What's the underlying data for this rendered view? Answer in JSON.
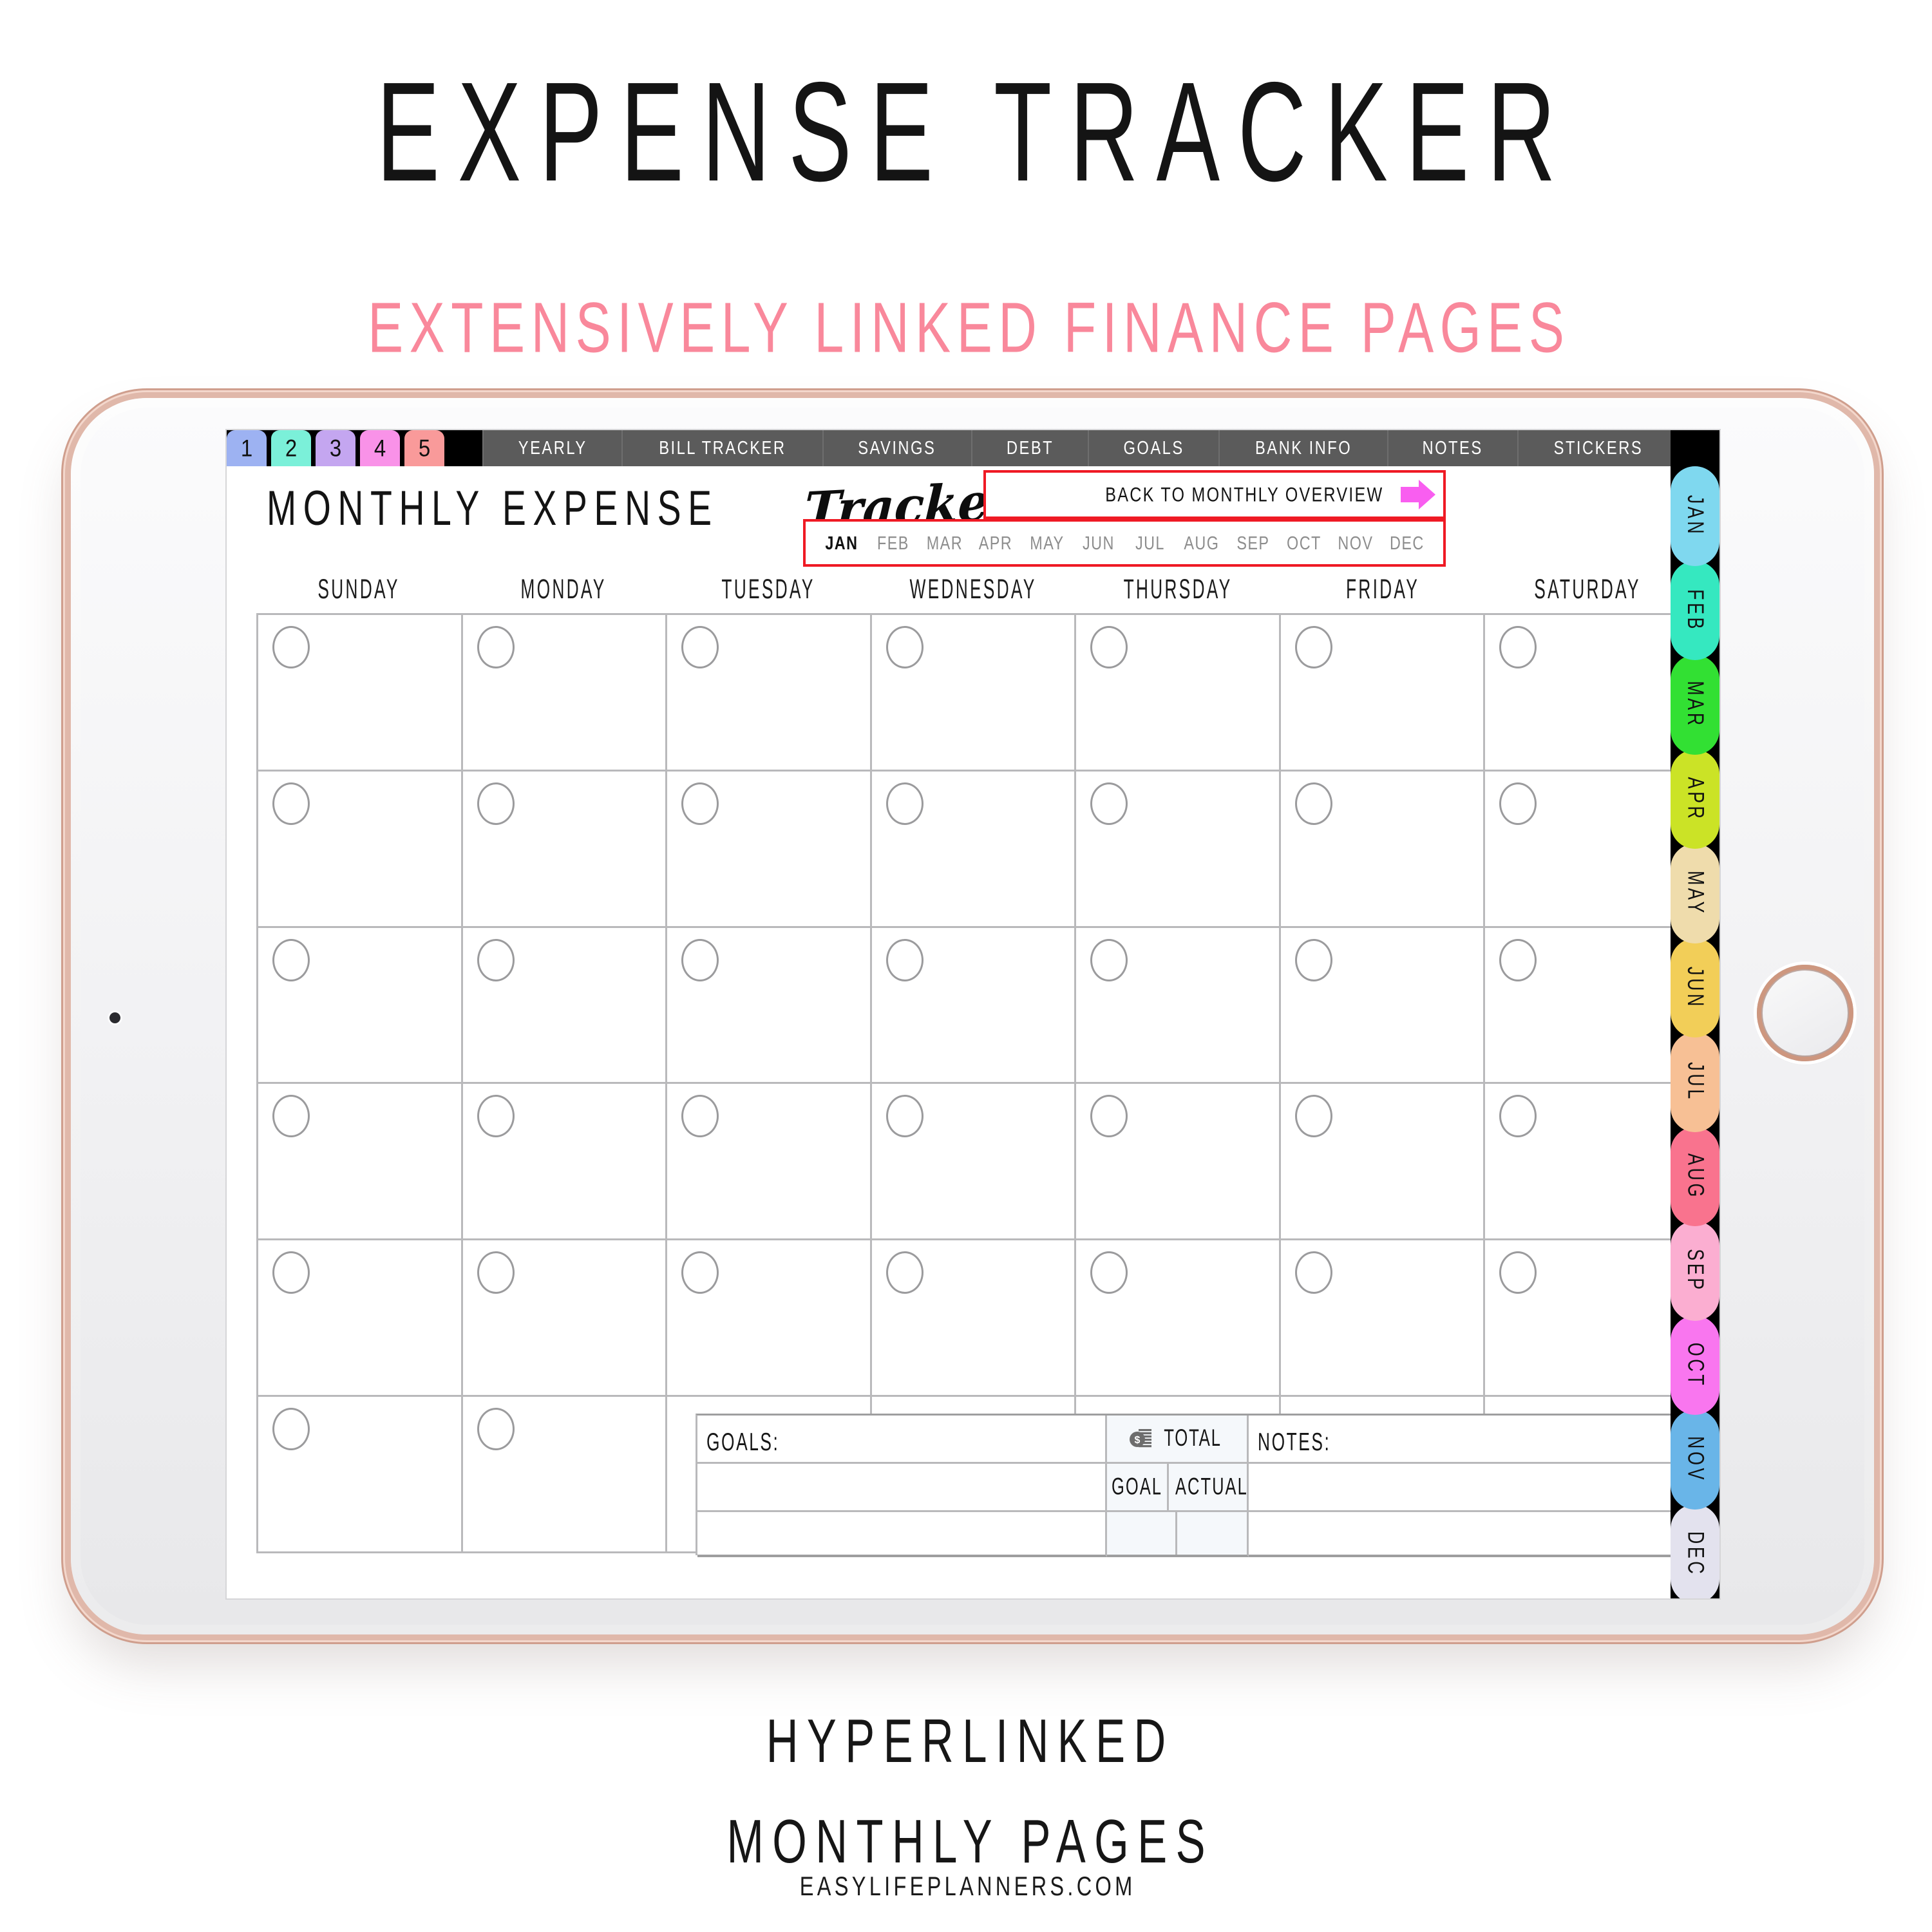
{
  "marketing": {
    "hero_title": "EXPENSE TRACKER",
    "hero_subtitle": "EXTENSIVELY LINKED FINANCE PAGES",
    "footer_line1": "HYPERLINKED",
    "footer_line2": "MONTHLY PAGES",
    "footer_url": "EASYLIFEPLANNERS.COM"
  },
  "colors": {
    "accent_pink": "#f9889b",
    "link_box_red": "#ef1a24",
    "arrow_magenta": "#f95ef0",
    "navbar_gray": "#5b5b5b",
    "device_rose_gold": "#cf9e8d",
    "grid_line": "#b9b9bb"
  },
  "device": {
    "home_button": "home-button",
    "camera": "front-camera"
  },
  "topnav": {
    "number_tabs": [
      {
        "label": "1",
        "color": "#9db2f2"
      },
      {
        "label": "2",
        "color": "#7bf0d9"
      },
      {
        "label": "3",
        "color": "#c4a6f0"
      },
      {
        "label": "4",
        "color": "#f992e8"
      },
      {
        "label": "5",
        "color": "#f99a9a"
      }
    ],
    "links": [
      "YEARLY",
      "BILL TRACKER",
      "SAVINGS",
      "DEBT",
      "GOALS",
      "BANK INFO",
      "NOTES",
      "STICKERS"
    ],
    "home_icon": "home-icon"
  },
  "page": {
    "title_thin": "MONTHLY EXPENSE",
    "title_script": "Tracker",
    "back_link": {
      "label": "BACK TO MONTHLY OVERVIEW",
      "arrow_icon": "arrow-right-icon"
    },
    "month_selector": {
      "active": "JAN",
      "months": [
        "JAN",
        "FEB",
        "MAR",
        "APR",
        "MAY",
        "JUN",
        "JUL",
        "AUG",
        "SEP",
        "OCT",
        "NOV",
        "DEC"
      ]
    },
    "day_headers": [
      "SUNDAY",
      "MONDAY",
      "TUESDAY",
      "WEDNESDAY",
      "THURSDAY",
      "FRIDAY",
      "SATURDAY"
    ],
    "calendar": {
      "rows": 6,
      "columns": 7,
      "date_circles_per_cell": 1
    },
    "bottom_section": {
      "goals_label": "GOALS:",
      "total_label": "TOTAL",
      "total_icon": "money-icon",
      "goal_label": "GOAL",
      "actual_label": "ACTUAL",
      "notes_label": "NOTES:"
    }
  },
  "month_tabs": [
    {
      "label": "JAN",
      "color": "#7fd8ef"
    },
    {
      "label": "FEB",
      "color": "#35e8c0"
    },
    {
      "label": "MAR",
      "color": "#32e033"
    },
    {
      "label": "APR",
      "color": "#cbe326"
    },
    {
      "label": "MAY",
      "color": "#efdcac"
    },
    {
      "label": "JUN",
      "color": "#f2ce58"
    },
    {
      "label": "JUL",
      "color": "#f7c095"
    },
    {
      "label": "AUG",
      "color": "#f9738e"
    },
    {
      "label": "SEP",
      "color": "#fbaed1"
    },
    {
      "label": "OCT",
      "color": "#f976ef"
    },
    {
      "label": "NOV",
      "color": "#69b5e8"
    },
    {
      "label": "DEC",
      "color": "#e3e2ee"
    }
  ]
}
